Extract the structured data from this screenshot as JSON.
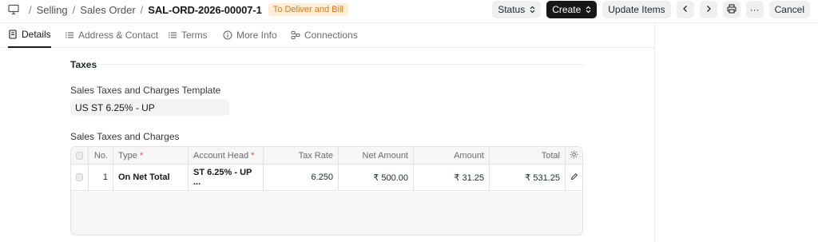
{
  "breadcrumb": {
    "items": [
      "Selling",
      "Sales Order"
    ],
    "title": "SAL-ORD-2026-00007-1",
    "status": "To Deliver and Bill"
  },
  "actions": {
    "status_label": "Status",
    "create_label": "Create",
    "update_items_label": "Update Items",
    "cancel_label": "Cancel",
    "more_label": "···"
  },
  "tabs": [
    {
      "label": "Details",
      "icon": "document-icon"
    },
    {
      "label": "Address & Contact",
      "icon": "list-icon"
    },
    {
      "label": "Terms",
      "icon": "list-icon"
    },
    {
      "label": "More Info",
      "icon": "info-icon"
    },
    {
      "label": "Connections",
      "icon": "connections-icon"
    }
  ],
  "section": {
    "title": "Taxes",
    "template_label": "Sales Taxes and Charges Template",
    "template_value": "US ST 6.25% - UP",
    "table_label": "Sales Taxes and Charges"
  },
  "table": {
    "headers": {
      "no": "No.",
      "type": "Type",
      "account_head": "Account Head",
      "tax_rate": "Tax Rate",
      "net_amount": "Net Amount",
      "amount": "Amount",
      "total": "Total",
      "required_mark": "*"
    },
    "rows": [
      {
        "no": "1",
        "type": "On Net Total",
        "account_head": "ST 6.25% - UP ...",
        "tax_rate": "6.250",
        "net_amount": "₹ 500.00",
        "amount": "₹ 31.25",
        "total": "₹ 531.25"
      }
    ]
  },
  "colors": {
    "status_bg": "#fdeed7",
    "status_text": "#d97a1a",
    "primary_button": "#171717"
  }
}
